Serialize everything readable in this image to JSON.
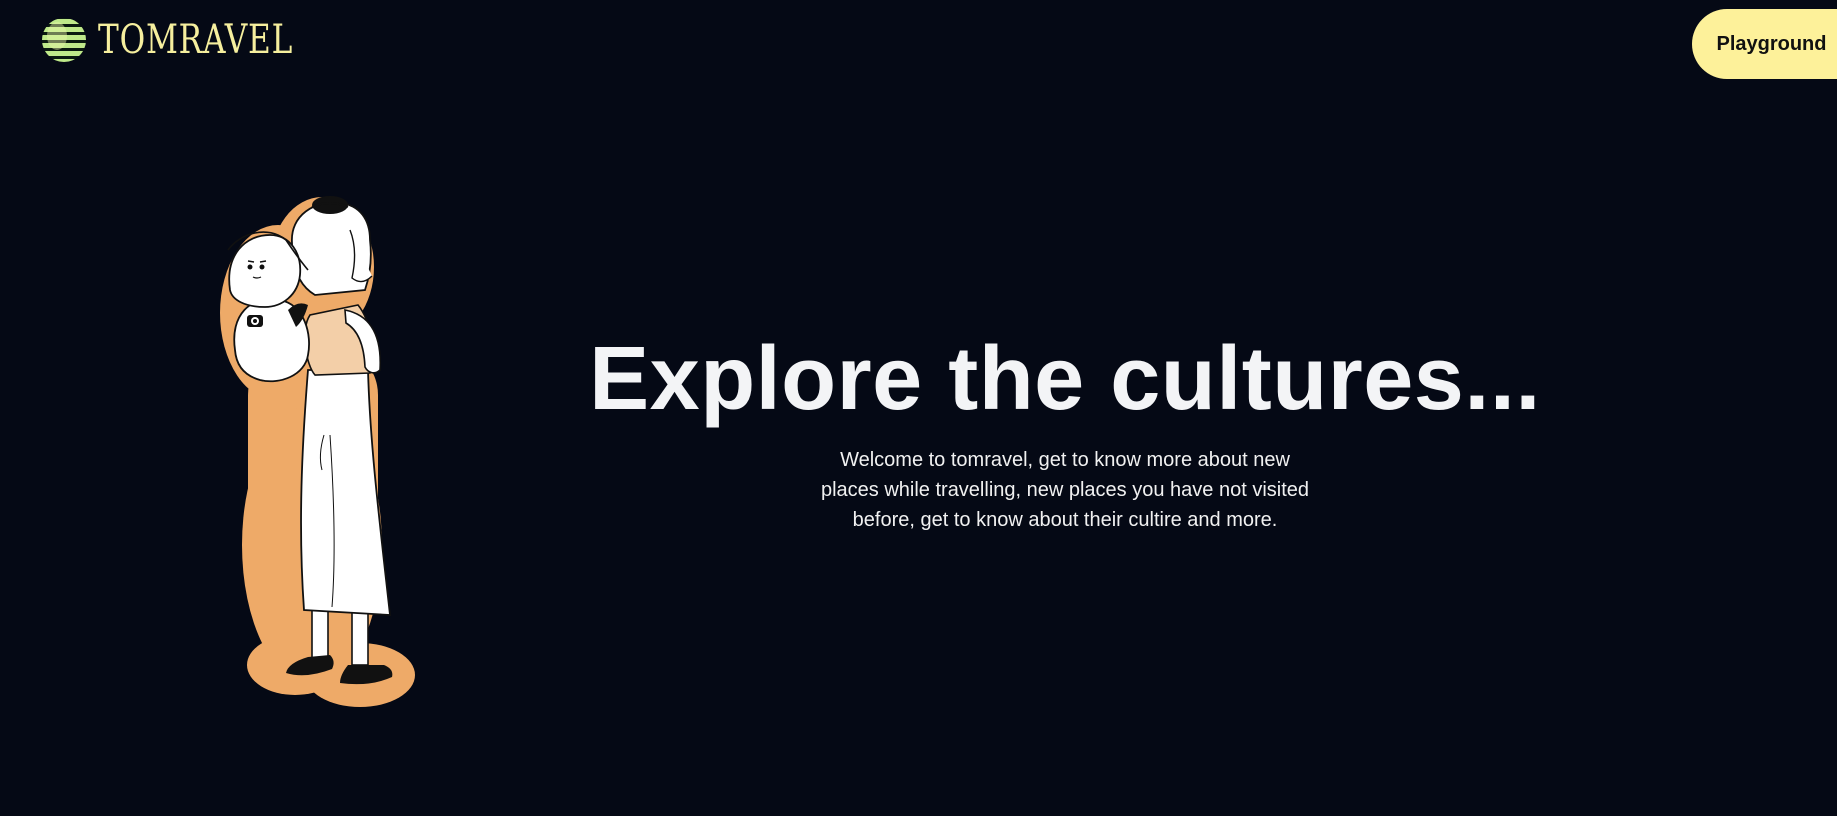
{
  "header": {
    "brand_name": "TOMRAVEL",
    "brand_icon": "striped-globe-icon",
    "brand_color": "#f6ef9e",
    "playground_label": "Playground",
    "playground_color": "#fdf19a"
  },
  "hero": {
    "title": "Explore the cultures...",
    "description": "Welcome to tomravel, get to know more about new places while travelling, new places you have not visited before, get to know about their cultire and more."
  },
  "illustration": {
    "subject": "traveler-with-backpack",
    "outline_color": "#eeaa68"
  },
  "theme": {
    "background": "#050915",
    "text": "#f3f4f6"
  }
}
